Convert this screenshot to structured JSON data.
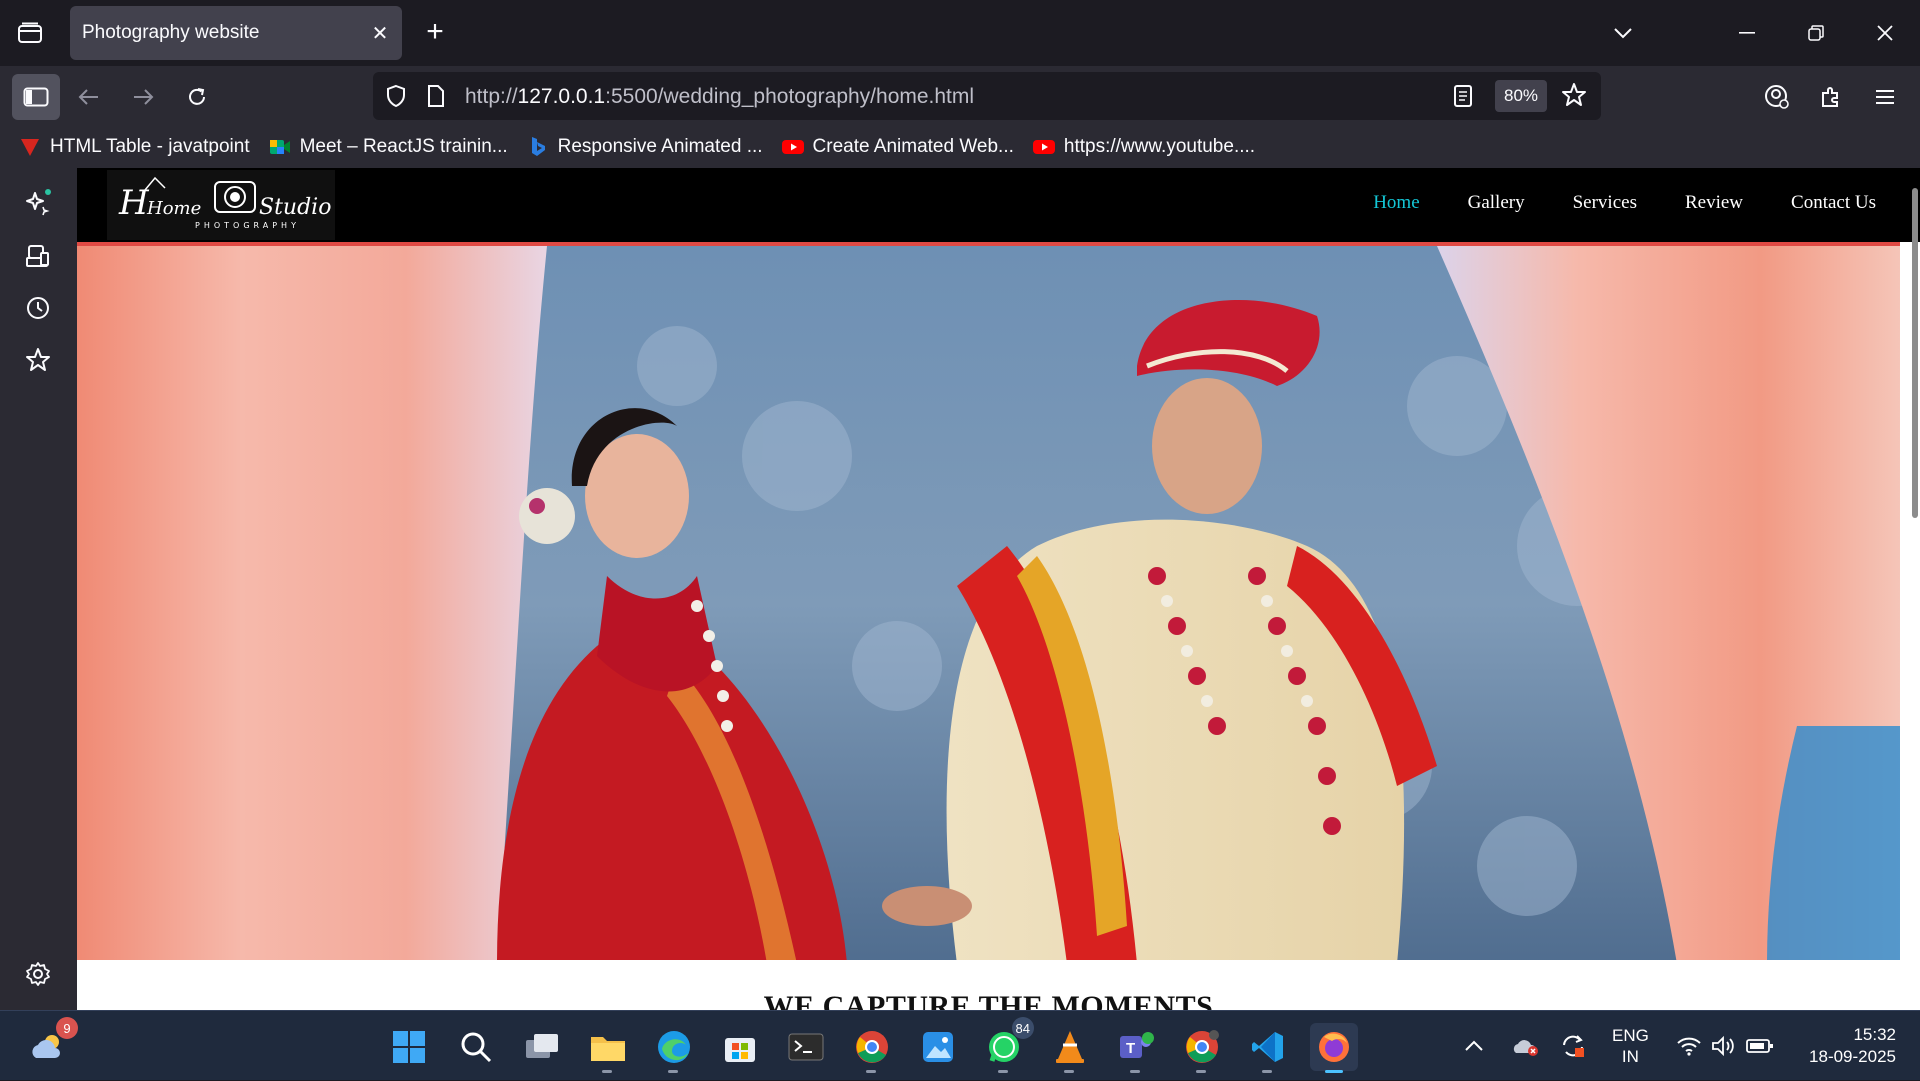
{
  "browser": {
    "tab": {
      "title": "Photography website"
    },
    "url": {
      "prefix": "http://",
      "host": "127.0.0.1",
      "rest": ":5500/wedding_photography/home.html"
    },
    "zoom": "80%",
    "bookmarks": [
      {
        "label": "HTML Table - javatpoint",
        "icon": "javatpoint-icon"
      },
      {
        "label": "Meet – ReactJS trainin...",
        "icon": "google-meet-icon"
      },
      {
        "label": "Responsive Animated ...",
        "icon": "bing-icon"
      },
      {
        "label": "Create Animated Web...",
        "icon": "youtube-icon"
      },
      {
        "label": "https://www.youtube....",
        "icon": "youtube-icon"
      }
    ]
  },
  "site": {
    "logo": {
      "script_left": "Home",
      "script_right": "Studio",
      "sub": "PHOTOGRAPHY"
    },
    "menu": [
      {
        "label": "Home",
        "active": true
      },
      {
        "label": "Gallery",
        "active": false
      },
      {
        "label": "Services",
        "active": false
      },
      {
        "label": "Review",
        "active": false
      },
      {
        "label": "Contact Us",
        "active": false
      }
    ],
    "section_heading": "WE CAPTURE THE MOMENTS"
  },
  "taskbar": {
    "weather_badge": "9",
    "whatsapp_badge": "84",
    "language": {
      "line1": "ENG",
      "line2": "IN"
    },
    "time": "15:32",
    "date": "18-09-2025"
  },
  "colors": {
    "active_menu": "#14c7d6",
    "accent_line": "#e04a44",
    "taskbar_bg": "#1f2a3d"
  }
}
